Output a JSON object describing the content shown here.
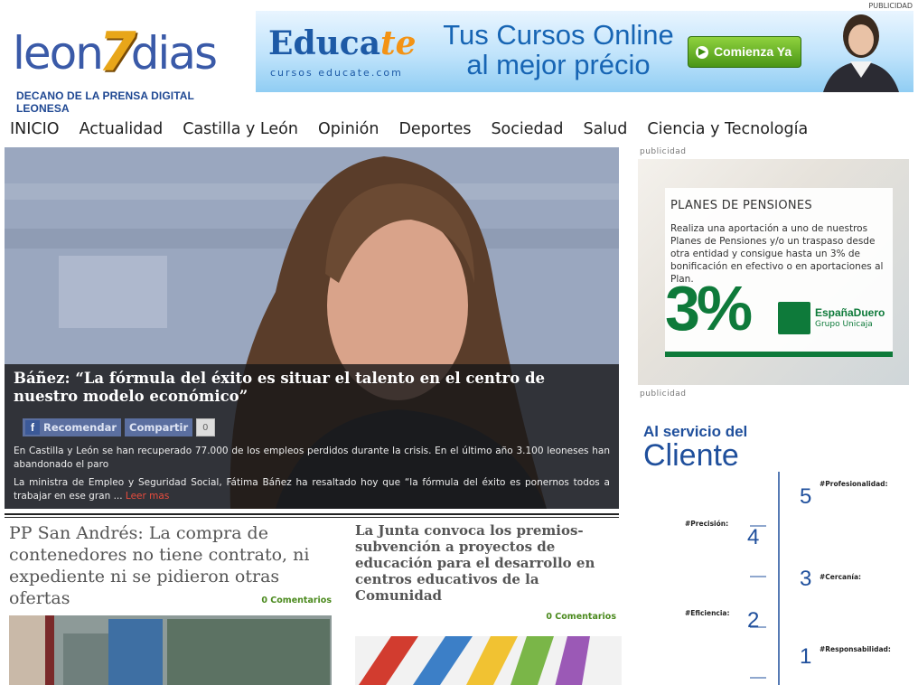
{
  "header": {
    "publicidad_top": "PUBLICIDAD",
    "logo": {
      "part1": "leon",
      "seven": "7",
      "part2": "dias",
      "tagline": "DECANO DE LA PRENSA DIGITAL LEONESA"
    },
    "banner": {
      "brand_main": "Educa",
      "brand_accent": "te",
      "brand_sub": "cursos educate.com",
      "title_line1": "Tus Cursos Online",
      "title_line2": "al mejor précio",
      "cta": "Comienza Ya"
    }
  },
  "nav": [
    "INICIO",
    "Actualidad",
    "Castilla y León",
    "Opinión",
    "Deportes",
    "Sociedad",
    "Salud",
    "Ciencia y Tecnología"
  ],
  "hero": {
    "title": "Báñez: “La fórmula del éxito es situar el talento en el centro de nuestro modelo económico”",
    "fb_label": "Recomendar",
    "share_label": "Compartir",
    "share_count": "0",
    "summary": "En Castilla y León se han recuperado 77.000 de los empleos perdidos durante la crisis. En el último año 3.100 leoneses han abandonado el paro",
    "excerpt": "La ministra de Empleo y Seguridad Social, Fátima Báñez ha resaltado hoy que “la fórmula del éxito es ponernos todos a trabajar en ese gran ...",
    "read_more": "Leer mas"
  },
  "articles": [
    {
      "title": "PP San Andrés: La compra de contenedores no tiene contrato, ni expediente ni se pidieron otras ofertas",
      "comments": "0 Comentarios"
    },
    {
      "title": "La Junta convoca los premios-subvención a proyectos de educación para el desarrollo en centros educativos de la Comunidad",
      "comments": "0 Comentarios"
    }
  ],
  "sidebar": {
    "ad_label": "publicidad",
    "ad1": {
      "title": "PLANES DE PENSIONES",
      "body": "Realiza una aportación a uno de nuestros Planes de Pensiones y/o un traspaso desde otra entidad y consigue hasta un 3% de bonificación en efectivo o en aportaciones al Plan.",
      "percent": "3%",
      "brand": "EspañaDuero",
      "brand_sub": "Grupo Unicaja"
    },
    "ad2": {
      "title_line1": "Al servicio del",
      "title_line2": "Cliente",
      "steps": [
        {
          "num": "5",
          "head": "#Profesionalidad:"
        },
        {
          "num": "4",
          "head": "#Precisión:"
        },
        {
          "num": "3",
          "head": "#Cercanía:"
        },
        {
          "num": "2",
          "head": "#Eficiencia:"
        },
        {
          "num": "1",
          "head": "#Responsabilidad:"
        }
      ]
    }
  },
  "colors": {
    "brand_blue": "#3a5aa8",
    "accent_orange": "#e8a619",
    "comments_green": "#4b8a1e",
    "read_more_red": "#e84c3d",
    "espanaduero_green": "#0e7a3a"
  }
}
